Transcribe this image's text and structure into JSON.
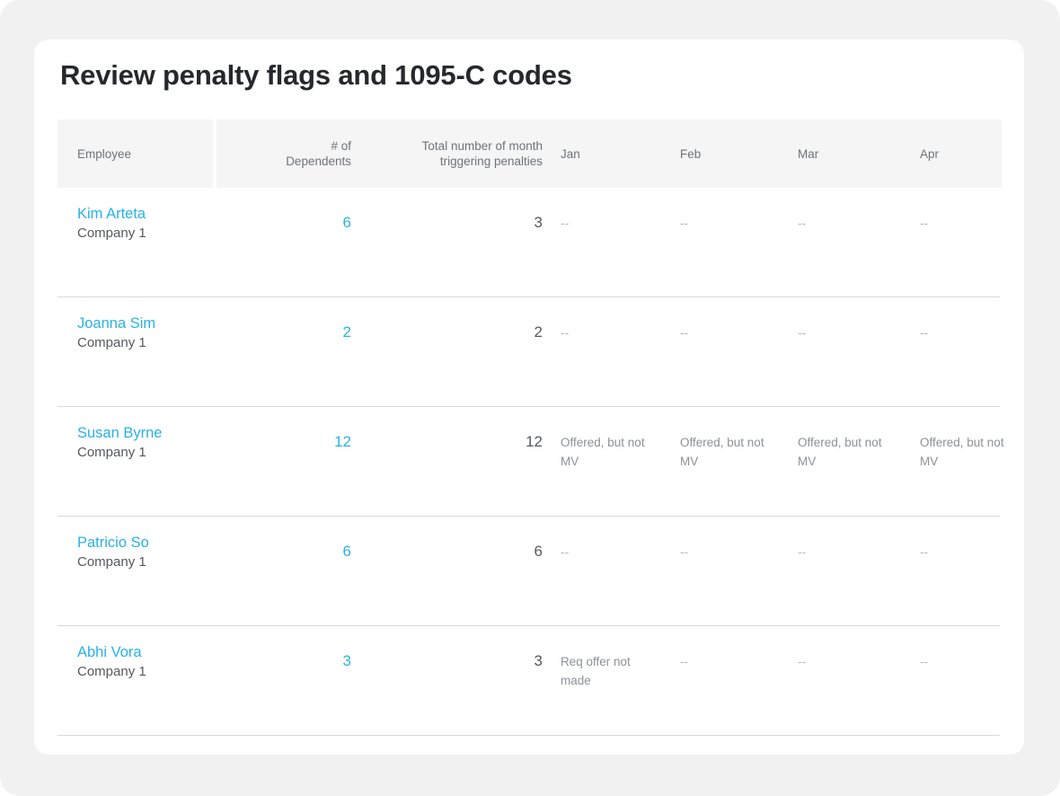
{
  "card": {
    "title": "Review penalty flags and 1095-C codes"
  },
  "table": {
    "headers": {
      "employee": "Employee",
      "dependents_line1": "# of",
      "dependents_line2": "Dependents",
      "total_line1": "Total number of month",
      "total_line2": "triggering penalties",
      "jan": "Jan",
      "feb": "Feb",
      "mar": "Mar",
      "apr": "Apr"
    },
    "rows": [
      {
        "name": "Kim Arteta",
        "company": "Company 1",
        "dependents": "6",
        "total_months": "3",
        "jan": "--",
        "feb": "--",
        "mar": "--",
        "apr": "--"
      },
      {
        "name": "Joanna Sim",
        "company": "Company 1",
        "dependents": "2",
        "total_months": "2",
        "jan": "--",
        "feb": "--",
        "mar": "--",
        "apr": "--"
      },
      {
        "name": "Susan Byrne",
        "company": "Company 1",
        "dependents": "12",
        "total_months": "12",
        "jan": "Offered, but not MV",
        "feb": "Offered, but not MV",
        "mar": "Offered, but not MV",
        "apr": "Offered, but not MV"
      },
      {
        "name": "Patricio So",
        "company": "Company 1",
        "dependents": "6",
        "total_months": "6",
        "jan": "--",
        "feb": "--",
        "mar": "--",
        "apr": "--"
      },
      {
        "name": "Abhi Vora",
        "company": "Company 1",
        "dependents": "3",
        "total_months": "3",
        "jan": "Req offer not made",
        "feb": "--",
        "mar": "--",
        "apr": "--"
      }
    ]
  },
  "colors": {
    "link": "#29b1e8",
    "text": "#55585c",
    "muted": "#8d9196",
    "header_bg": "#f5f5f5",
    "page_bg": "#f1f1f1",
    "divider": "#d8d8d8"
  }
}
